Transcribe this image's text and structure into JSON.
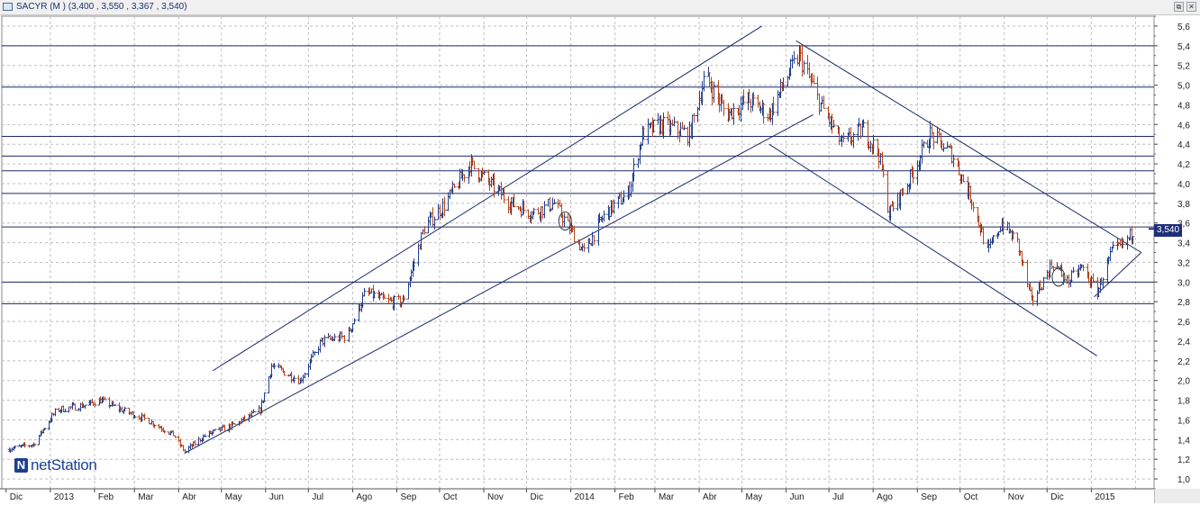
{
  "window": {
    "title": "SACYR (M ) (3,400 , 3,550 , 3,367 , 3,540)",
    "restore_label": "⧉",
    "close_label": "✕"
  },
  "brand": {
    "logo_letter": "N",
    "text": "netStation"
  },
  "last_price": {
    "label": "3,540",
    "value": 3.54
  },
  "colors": {
    "up_bar": "#1f3f8f",
    "down_bar": "#b4451e",
    "level_line": "#1a2a6a",
    "trend_line": "#1a2a6a",
    "grid": "#bfbfbf",
    "badge": "#1e2f78"
  },
  "chart_data": {
    "type": "ohlc",
    "title": "SACYR (M ) (3,400 , 3,550 , 3,367 , 3,540)",
    "xlabel": "",
    "ylabel": "",
    "ylim": [
      0.9,
      5.7
    ],
    "yticks": [
      "1,0",
      "1,2",
      "1,4",
      "1,6",
      "1,8",
      "2,0",
      "2,2",
      "2,4",
      "2,6",
      "2,8",
      "3,0",
      "3,2",
      "3,4",
      "3,6",
      "3,8",
      "4,0",
      "4,2",
      "4,4",
      "4,6",
      "4,8",
      "5,0",
      "5,2",
      "5,4",
      "5,6"
    ],
    "xticks": [
      "Dic",
      "2013",
      "Feb",
      "Mar",
      "Abr",
      "May",
      "Jun",
      "Jul",
      "Ago",
      "Sep",
      "Oct",
      "Nov",
      "Dic",
      "2014",
      "Feb",
      "Mar",
      "Abr",
      "May",
      "Jun",
      "Jul",
      "Ago",
      "Sep",
      "Oct",
      "Nov",
      "Dic",
      "2015"
    ],
    "grid": true,
    "price_path": [
      {
        "date": "2012-12-01",
        "close": 1.3
      },
      {
        "date": "2012-12-20",
        "close": 1.35
      },
      {
        "date": "2013-01-05",
        "close": 1.7
      },
      {
        "date": "2013-01-25",
        "close": 1.75
      },
      {
        "date": "2013-02-05",
        "close": 1.8
      },
      {
        "date": "2013-02-20",
        "close": 1.7
      },
      {
        "date": "2013-03-10",
        "close": 1.6
      },
      {
        "date": "2013-03-28",
        "close": 1.45
      },
      {
        "date": "2013-04-05",
        "close": 1.28
      },
      {
        "date": "2013-04-20",
        "close": 1.45
      },
      {
        "date": "2013-05-10",
        "close": 1.55
      },
      {
        "date": "2013-05-28",
        "close": 1.7
      },
      {
        "date": "2013-06-05",
        "close": 2.15
      },
      {
        "date": "2013-06-25",
        "close": 2.0
      },
      {
        "date": "2013-07-10",
        "close": 2.4
      },
      {
        "date": "2013-07-28",
        "close": 2.45
      },
      {
        "date": "2013-08-10",
        "close": 2.9
      },
      {
        "date": "2013-08-25",
        "close": 2.8
      },
      {
        "date": "2013-09-05",
        "close": 2.8
      },
      {
        "date": "2013-09-20",
        "close": 3.55
      },
      {
        "date": "2013-10-05",
        "close": 3.8
      },
      {
        "date": "2013-10-22",
        "close": 4.2
      },
      {
        "date": "2013-11-05",
        "close": 4.0
      },
      {
        "date": "2013-11-20",
        "close": 3.8
      },
      {
        "date": "2013-12-05",
        "close": 3.7
      },
      {
        "date": "2013-12-20",
        "close": 3.8
      },
      {
        "date": "2014-01-02",
        "close": 3.5
      },
      {
        "date": "2014-01-10",
        "close": 3.3
      },
      {
        "date": "2014-01-25",
        "close": 3.7
      },
      {
        "date": "2014-02-10",
        "close": 3.9
      },
      {
        "date": "2014-02-20",
        "close": 4.5
      },
      {
        "date": "2014-03-05",
        "close": 4.6
      },
      {
        "date": "2014-03-25",
        "close": 4.5
      },
      {
        "date": "2014-04-05",
        "close": 5.1
      },
      {
        "date": "2014-04-20",
        "close": 4.7
      },
      {
        "date": "2014-05-05",
        "close": 4.85
      },
      {
        "date": "2014-05-20",
        "close": 4.7
      },
      {
        "date": "2014-06-02",
        "close": 5.1
      },
      {
        "date": "2014-06-10",
        "close": 5.3
      },
      {
        "date": "2014-06-25",
        "close": 4.8
      },
      {
        "date": "2014-07-10",
        "close": 4.4
      },
      {
        "date": "2014-07-25",
        "close": 4.55
      },
      {
        "date": "2014-08-05",
        "close": 4.3
      },
      {
        "date": "2014-08-12",
        "close": 3.7
      },
      {
        "date": "2014-08-25",
        "close": 4.0
      },
      {
        "date": "2014-09-10",
        "close": 4.5
      },
      {
        "date": "2014-09-25",
        "close": 4.3
      },
      {
        "date": "2014-10-10",
        "close": 3.8
      },
      {
        "date": "2014-10-20",
        "close": 3.3
      },
      {
        "date": "2014-10-30",
        "close": 3.6
      },
      {
        "date": "2014-11-10",
        "close": 3.4
      },
      {
        "date": "2014-11-20",
        "close": 2.8
      },
      {
        "date": "2014-12-05",
        "close": 3.2
      },
      {
        "date": "2014-12-15",
        "close": 3.0
      },
      {
        "date": "2014-12-25",
        "close": 3.15
      },
      {
        "date": "2015-01-05",
        "close": 2.9
      },
      {
        "date": "2015-01-15",
        "close": 3.3
      },
      {
        "date": "2015-01-25",
        "close": 3.4
      },
      {
        "date": "2015-01-31",
        "close": 3.54
      }
    ],
    "levels": [
      5.4,
      4.98,
      4.48,
      4.28,
      4.13,
      3.9,
      3.56,
      3.0,
      2.78
    ],
    "trendlines": [
      {
        "name": "upper-channel",
        "from": {
          "date": "2013-04-25",
          "value": 2.1
        },
        "to": {
          "date": "2014-05-15",
          "value": 5.6
        }
      },
      {
        "name": "lower-channel",
        "from": {
          "date": "2013-04-05",
          "value": 1.26
        },
        "to": {
          "date": "2014-06-20",
          "value": 4.7
        }
      },
      {
        "name": "down-upper",
        "from": {
          "date": "2014-06-08",
          "value": 5.45
        },
        "to": {
          "date": "2015-02-05",
          "value": 3.3
        }
      },
      {
        "name": "down-lower",
        "from": {
          "date": "2014-05-20",
          "value": 4.4
        },
        "to": {
          "date": "2015-01-05",
          "value": 2.25
        }
      },
      {
        "name": "short-uptrend",
        "from": {
          "date": "2015-01-03",
          "value": 2.85
        },
        "to": {
          "date": "2015-02-05",
          "value": 3.3
        }
      }
    ],
    "circle_marks": [
      {
        "date": "2013-12-28",
        "value": 3.62
      },
      {
        "date": "2014-12-09",
        "value": 3.05
      }
    ],
    "last_close": 3.54
  }
}
